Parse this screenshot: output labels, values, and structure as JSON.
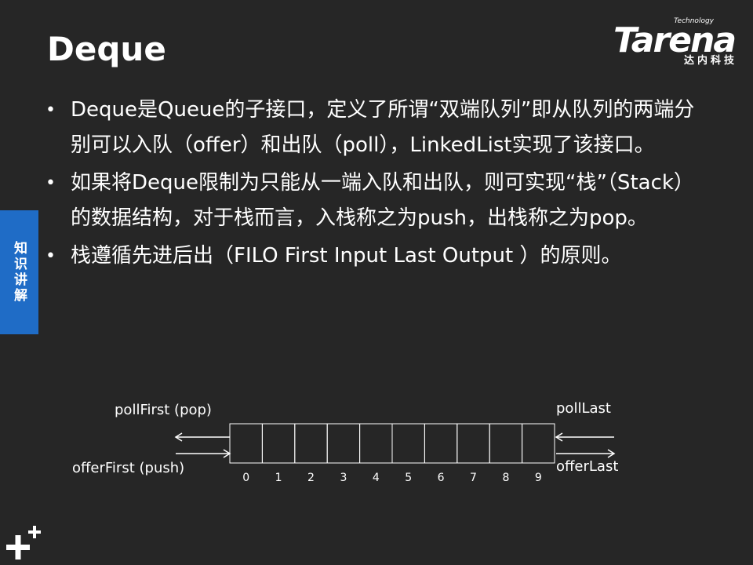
{
  "slide": {
    "title": "Deque",
    "side_tab": "知识讲解",
    "bullets": [
      "Deque是Queue的子接口，定义了所谓“双端队列”即从队列的两端分别可以入队（offer）和出队（poll），LinkedList实现了该接口。",
      "如果将Deque限制为只能从一端入队和出队，则可实现“栈”（Stack）的数据结构，对于栈而言，入栈称之为push，出栈称之为pop。",
      "栈遵循先进后出（FILO First Input Last Output ）的原则。"
    ]
  },
  "logo": {
    "tagline": "Technology",
    "word": "Tarena",
    "sub": "达内科技"
  },
  "diagram": {
    "left_top_label": "pollFirst (pop)",
    "left_bottom_label": "offerFirst (push)",
    "right_top_label": "pollLast",
    "right_bottom_label": "offerLast",
    "cell_indices": [
      "0",
      "1",
      "2",
      "3",
      "4",
      "5",
      "6",
      "7",
      "8",
      "9"
    ]
  }
}
